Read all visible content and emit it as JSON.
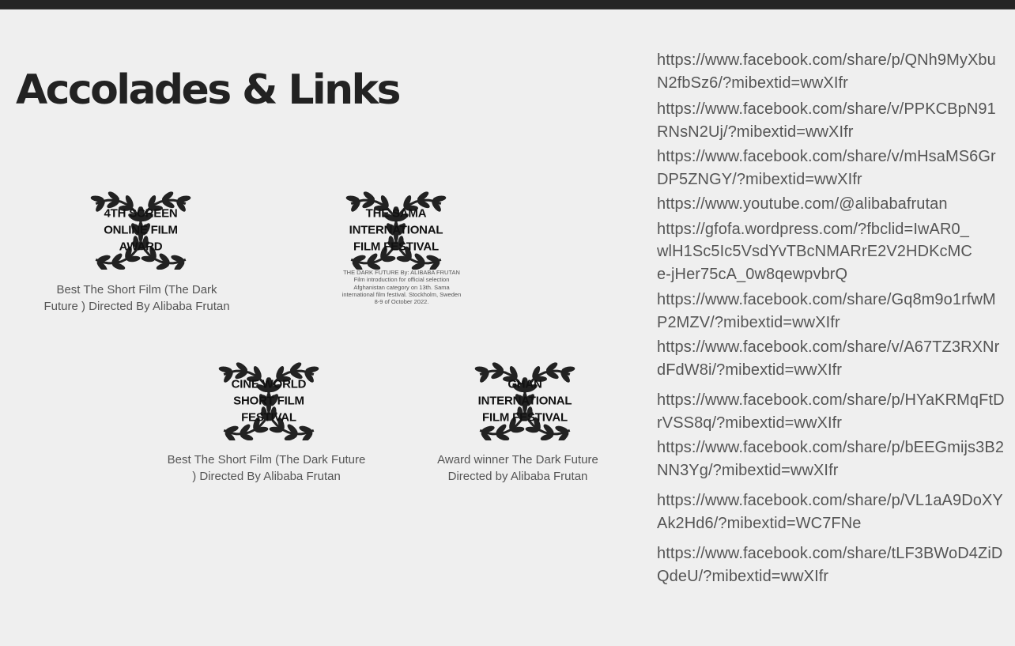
{
  "page": {
    "title": "Accolades & Links"
  },
  "awards": [
    {
      "name": "4TH SCREEN ONLINE FILM AWARD",
      "caption": "Best The Short Film (The Dark Future ) Directed By Alibaba Frutan"
    },
    {
      "name": "THE SAMA INTERNATIONAL FILM FESTIVAL",
      "note": "THE DARK FUTURE By: ALIBABA FRUTAN Film introduction for official selection Afghanistan category on 13th. Sama international film festival. Stockholm, Sweden 8-9 of October 2022."
    },
    {
      "name": "CINE WORLD SHORT FILM FESTIVAL",
      "caption": "Best The Short Film (The Dark Future ) Directed By Alibaba Frutan"
    },
    {
      "name": "GHAN INTERNATIONAL FILM FESTIVAL",
      "caption": "Award winner The Dark Future Directed by Alibaba Frutan"
    }
  ],
  "links": [
    "https://www.facebook.com/share/p/QNh9MyXbuN2fbSz6/?mibextid=wwXIfr",
    "https://www.facebook.com/share/v/PPKCBpN91RNsN2Uj/?mibextid=wwXIfr",
    "https://www.facebook.com/share/v/mHsaMS6GrDP5ZNGY/?mibextid=wwXIfr",
    "https://www.youtube.com/@alibabafrutan",
    "https://gfofa.wordpress.com/?fbclid=IwAR0_wlH1Sc5Ic5VsdYvTBcNMARrE2V2HDKcMCe-jHer75cA_0w8qewpvbrQ",
    "https://www.facebook.com/share/Gq8m9o1rfwMP2MZV/?mibextid=wwXIfr",
    "https://www.facebook.com/share/v/A67TZ3RXNrdFdW8i/?mibextid=wwXIfr",
    "https://www.facebook.com/share/p/HYaKRMqFtDrVSS8q/?mibextid=wwXIfr",
    "https://www.facebook.com/share/p/bEEGmijs3B2NN3Yg/?mibextid=wwXIfr",
    "https://www.facebook.com/share/p/VL1aA9DoXYAk2Hd6/?mibextid=WC7FNe",
    "https://www.facebook.com/share/tLF3BWoD4ZiDQdeU/?mibextid=wwXIfr"
  ],
  "colors": {
    "background": "#efefef",
    "topbar": "#252525",
    "title": "#222222",
    "text": "#555555",
    "laurel": "#222222"
  },
  "icons": {
    "laurel": "laurel-wreath-icon"
  }
}
